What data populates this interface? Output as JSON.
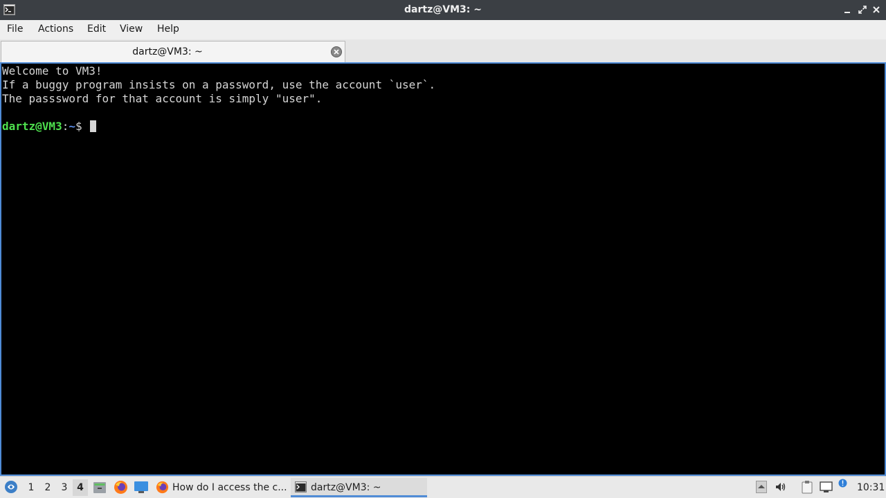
{
  "window": {
    "title": "dartz@VM3: ~"
  },
  "menu": {
    "items": [
      "File",
      "Actions",
      "Edit",
      "View",
      "Help"
    ]
  },
  "tab": {
    "label": "dartz@VM3: ~"
  },
  "terminal": {
    "lines": [
      "Welcome to VM3!",
      "If a buggy program insists on a password, use the account `user`.",
      "The passsword for that account is simply \"user\"."
    ],
    "prompt_user": "dartz@VM3",
    "prompt_sep": ":",
    "prompt_path": "~",
    "prompt_symbol": "$ "
  },
  "taskbar": {
    "workspaces": [
      "1",
      "2",
      "3",
      "4"
    ],
    "active_workspace": "4",
    "tasks": [
      {
        "label": "How do I access the c...",
        "icon": "firefox-icon"
      },
      {
        "label": "dartz@VM3: ~",
        "icon": "terminal-icon"
      }
    ],
    "clock": "10:31"
  },
  "colors": {
    "titlebar": "#3b3f44",
    "terminal_bg": "#000000",
    "prompt_user": "#4ee04e",
    "prompt_path": "#5b8de8",
    "accent": "#4f8bd6"
  }
}
